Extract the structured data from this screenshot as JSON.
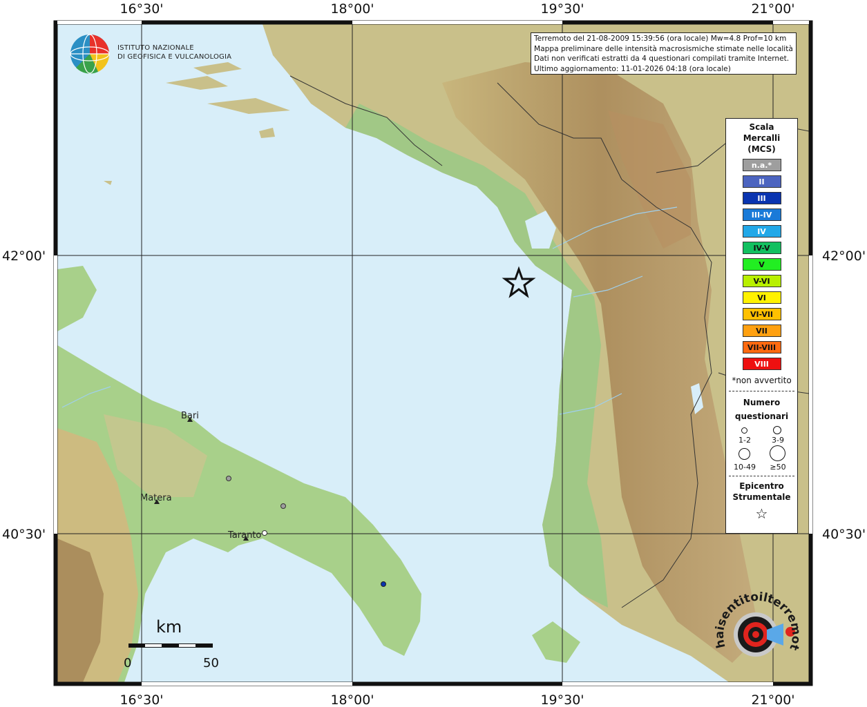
{
  "info": {
    "line1": "Terremoto del 21-08-2009 15:39:56 (ora locale) Mw=4.8 Prof=10 km",
    "line2": "Mappa preliminare delle intensità macrosismiche stimate nelle località",
    "line3": "Dati non verificati estratti da 4 questionari compilati tramite Internet.",
    "line4": "Ultimo aggiornamento: 11-01-2026 04:18 (ora locale)"
  },
  "ingv": {
    "line1": "ISTITUTO NAZIONALE",
    "line2": "DI GEOFISICA E VULCANOLOGIA"
  },
  "ticks": {
    "lon": [
      "16°30'",
      "18°00'",
      "19°30'",
      "21°00'"
    ],
    "lat": [
      "42°00'",
      "40°30'"
    ]
  },
  "cities": [
    {
      "name": "Bari"
    },
    {
      "name": "Matera"
    },
    {
      "name": "Taranto"
    }
  ],
  "scalebar": {
    "unit": "km",
    "min": "0",
    "max": "50"
  },
  "legend": {
    "title_lines": [
      "Scala",
      "Mercalli",
      "(MCS)"
    ],
    "items": [
      {
        "label": "n.a.*",
        "color": "#9e9e9e",
        "text": "#ffffff"
      },
      {
        "label": "II",
        "color": "#4c64c0",
        "text": "#ffffff"
      },
      {
        "label": "III",
        "color": "#0a34b0",
        "text": "#ffffff"
      },
      {
        "label": "III-IV",
        "color": "#1a7ad8",
        "text": "#ffffff"
      },
      {
        "label": "IV",
        "color": "#22a8e8",
        "text": "#ffffff"
      },
      {
        "label": "IV-V",
        "color": "#12c060",
        "text": "#111111"
      },
      {
        "label": "V",
        "color": "#22ee22",
        "text": "#111111"
      },
      {
        "label": "V-VI",
        "color": "#b8f000",
        "text": "#111111"
      },
      {
        "label": "VI",
        "color": "#fff200",
        "text": "#111111"
      },
      {
        "label": "VI-VII",
        "color": "#ffc000",
        "text": "#111111"
      },
      {
        "label": "VII",
        "color": "#ffa010",
        "text": "#111111"
      },
      {
        "label": "VII-VIII",
        "color": "#ff6a10",
        "text": "#111111"
      },
      {
        "label": "VIII",
        "color": "#ee1010",
        "text": "#ffffff"
      }
    ],
    "note": "*non avvertito",
    "numero_title": "Numero",
    "numero_subtitle": "questionari",
    "sizes": [
      "1-2",
      "3-9",
      "10-49",
      "≥50"
    ],
    "epicentro_line1": "Epicentro",
    "epicentro_line2": "Strumentale",
    "star": "☆"
  },
  "observations": [
    {
      "name": "grey-point-1",
      "mcs": "n.a.*",
      "color": "#9e9e9e"
    },
    {
      "name": "grey-point-2",
      "mcs": "n.a.*",
      "color": "#9e9e9e"
    },
    {
      "name": "grey-point-3",
      "mcs": "n.a.*",
      "color": "#9e9e9e"
    },
    {
      "name": "blue-point",
      "mcs": "III",
      "color": "#0a34b0"
    }
  ],
  "colors": {
    "sea": "#d8eef9",
    "lowland": "#a8d08a",
    "hills": "#d9c48a",
    "mountains": "#b08a5a"
  },
  "hst_logo_text": "haisentitoilterremoto.it www."
}
